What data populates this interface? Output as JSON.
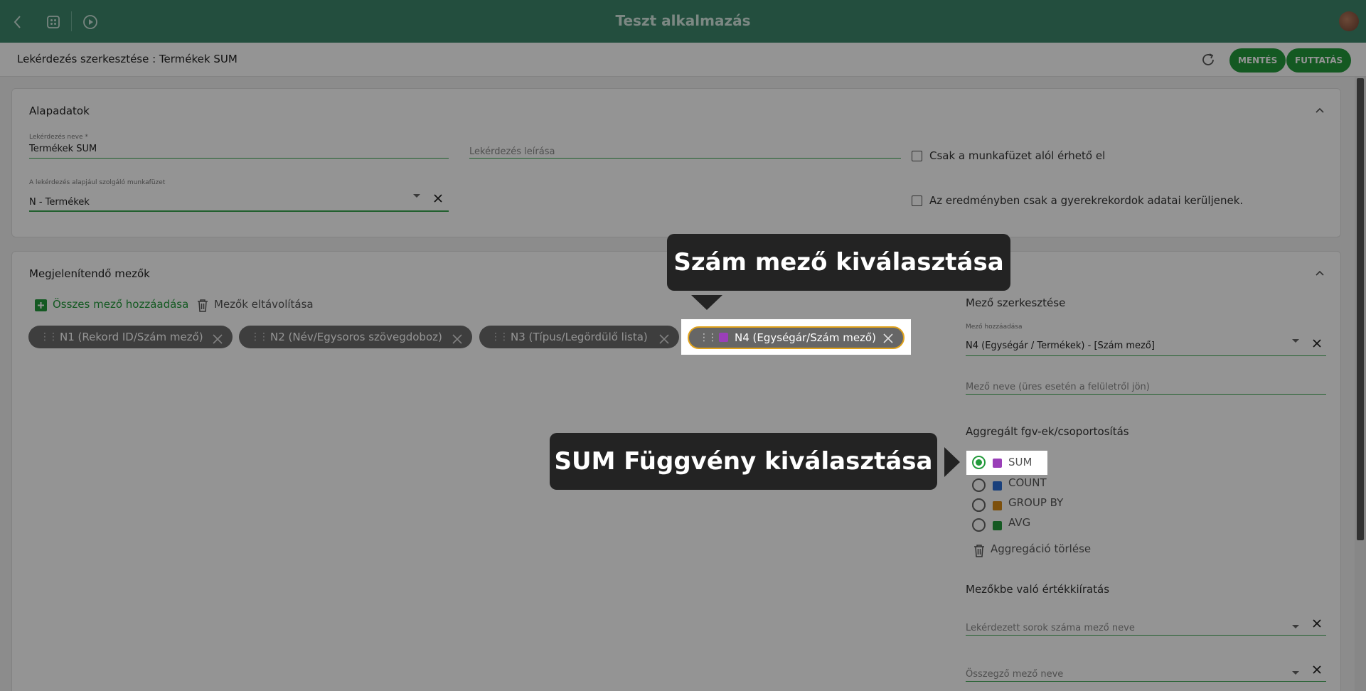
{
  "app": {
    "title": "Teszt alkalmazás"
  },
  "header": {
    "breadcrumb": "Lekérdezés szerkesztése : Termékek SUM",
    "save_label": "MENTÉS",
    "run_label": "FUTTATÁS"
  },
  "basic": {
    "title": "Alapadatok",
    "name_label": "Lekérdezés neve *",
    "name_value": "Termékek SUM",
    "description_placeholder": "Lekérdezés leírása",
    "workbook_label": "A lekérdezés alapjául szolgáló munkafüzet",
    "workbook_value": "N - Termékek",
    "checkbox1": "Csak a munkafüzet alól érhető el",
    "checkbox2": "Az eredményben csak a gyerekrekordok adatai kerüljenek."
  },
  "fields": {
    "title": "Megjelenítendő mezők",
    "add_all": "Összes mező hozzáadása",
    "remove": "Mezők eltávolítása",
    "chips": [
      {
        "label": "N1 (Rekord ID/Szám mező)"
      },
      {
        "label": "N2 (Név/Egysoros szövegdoboz)"
      },
      {
        "label": "N3 (Típus/Legördülő lista)"
      },
      {
        "label": "N4 (Egységár/Szám mező)",
        "color": "#9a3fb8"
      }
    ]
  },
  "editor": {
    "title": "Mező szerkesztése",
    "add_label": "Mező hozzáadása",
    "add_value": "N4 (Egységár / Termékek) - [Szám mező]",
    "name_placeholder": "Mező neve (üres esetén a felületről jön)",
    "agg_title": "Aggregált fgv-ek/csoportosítás",
    "agg_options": [
      {
        "label": "SUM",
        "color": "#9a3fb8",
        "selected": true
      },
      {
        "label": "COUNT",
        "color": "#2b6fd6",
        "selected": false
      },
      {
        "label": "GROUP BY",
        "color": "#d88a16",
        "selected": false
      },
      {
        "label": "AVG",
        "color": "#239a3b",
        "selected": false
      }
    ],
    "agg_delete": "Aggregáció törlése",
    "output_title": "Mezőkbe való értékkiíratás",
    "rows_placeholder": "Lekérdezett sorok száma mező neve",
    "sum_placeholder": "Összegző mező neve"
  },
  "tooltips": {
    "field_select": "Szám mező kiválasztása",
    "sum_select": "SUM Függvény kiválasztása"
  },
  "colors": {
    "brand": "#3d876c",
    "accent": "#239a3b"
  }
}
